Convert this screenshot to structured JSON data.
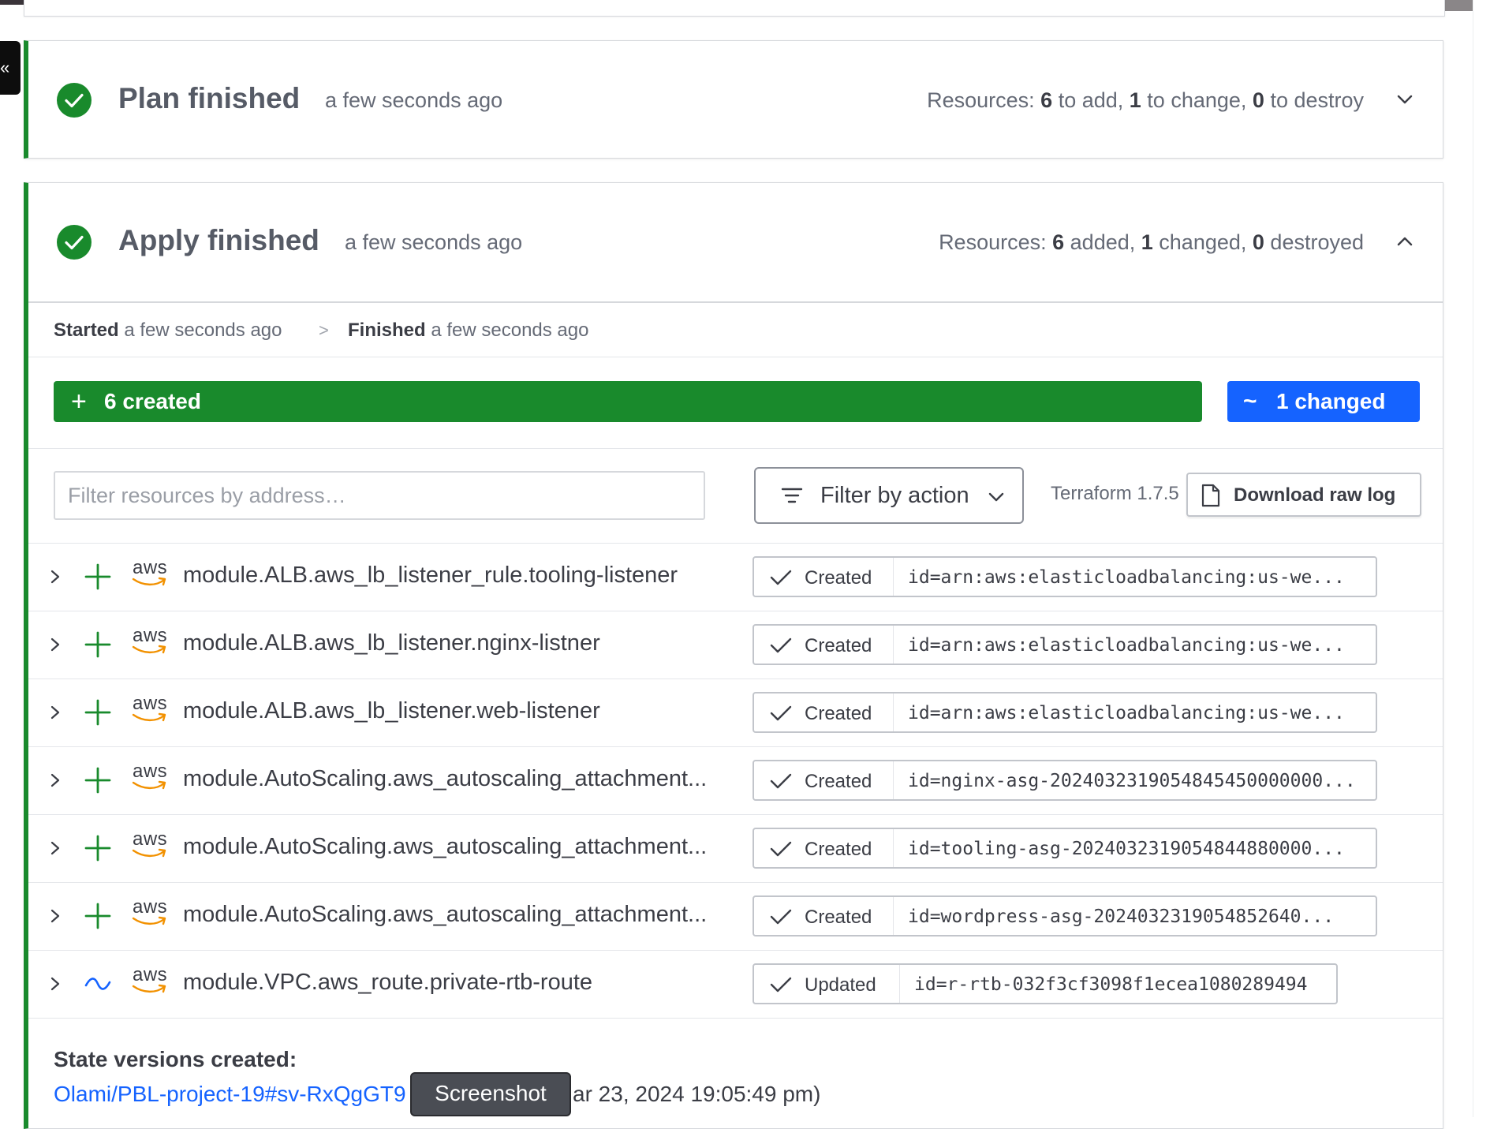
{
  "side_tab": {
    "glyph": "«"
  },
  "plan": {
    "title": "Plan finished",
    "time": "a few seconds ago",
    "resources_prefix": "Resources: ",
    "add_count": "6",
    "add_label": " to add, ",
    "change_count": "1",
    "change_label": " to change, ",
    "destroy_count": "0",
    "destroy_label": " to destroy",
    "expand_icon": "chevron-down-icon"
  },
  "apply": {
    "title": "Apply finished",
    "time": "a few seconds ago",
    "resources_prefix": "Resources: ",
    "added_count": "6",
    "added_label": " added, ",
    "changed_count": "1",
    "changed_label": " changed, ",
    "destroyed_count": "0",
    "destroyed_label": " destroyed",
    "collapse_icon": "chevron-up-icon",
    "started_label": "Started",
    "started_time": " a few seconds ago",
    "separator": ">",
    "finished_label": "Finished",
    "finished_time": " a few seconds ago",
    "created_symbol": "+",
    "created_label": "6 created",
    "changed_symbol": "~",
    "changed_bar_label": "1 changed",
    "colors": {
      "created": "#198a2c",
      "changed": "#1563ff"
    }
  },
  "toolbar": {
    "filter_placeholder": "Filter resources by address…",
    "filter_action_label": "Filter by action",
    "terraform_version": "Terraform 1.7.5",
    "download_label": "Download raw log"
  },
  "resources": [
    {
      "action": "create",
      "provider": "aws",
      "address": "module.ALB.aws_lb_listener_rule.tooling-listener",
      "status": "Created",
      "id": "id=arn:aws:elasticloadbalancing:us-we..."
    },
    {
      "action": "create",
      "provider": "aws",
      "address": "module.ALB.aws_lb_listener.nginx-listner",
      "status": "Created",
      "id": "id=arn:aws:elasticloadbalancing:us-we..."
    },
    {
      "action": "create",
      "provider": "aws",
      "address": "module.ALB.aws_lb_listener.web-listener",
      "status": "Created",
      "id": "id=arn:aws:elasticloadbalancing:us-we..."
    },
    {
      "action": "create",
      "provider": "aws",
      "address": "module.AutoScaling.aws_autoscaling_attachment...",
      "status": "Created",
      "id": "id=nginx-asg-2024032319054845450000000..."
    },
    {
      "action": "create",
      "provider": "aws",
      "address": "module.AutoScaling.aws_autoscaling_attachment...",
      "status": "Created",
      "id": "id=tooling-asg-2024032319054844880000..."
    },
    {
      "action": "create",
      "provider": "aws",
      "address": "module.AutoScaling.aws_autoscaling_attachment...",
      "status": "Created",
      "id": "id=wordpress-asg-2024032319054852640..."
    },
    {
      "action": "update",
      "provider": "aws",
      "address": "module.VPC.aws_route.private-rtb-route",
      "status": "Updated",
      "id": "id=r-rtb-032f3cf3098f1ecea1080289494"
    }
  ],
  "state": {
    "title": "State versions created:",
    "link_text": "Olami/PBL-project-19#sv-RxQgGT9",
    "tail_text": "ar 23, 2024 19:05:49 pm)"
  },
  "tooltip": {
    "label": "Screenshot"
  }
}
